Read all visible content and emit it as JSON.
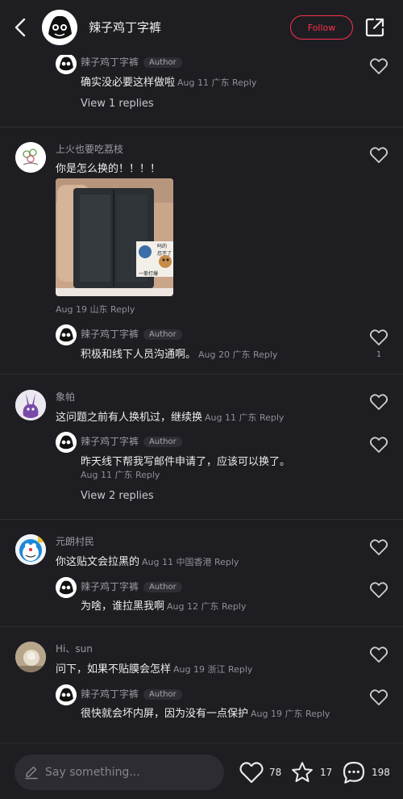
{
  "header": {
    "title": "辣子鸡丁字裤",
    "follow_label": "Follow"
  },
  "comments": {
    "c0": {
      "reply": {
        "user": "辣子鸡丁字裤",
        "badge": "Author",
        "text": "确实没必要这样做啦",
        "meta": "Aug 11 广东 Reply"
      },
      "view_replies": "View 1 replies"
    },
    "c1": {
      "user": "上火也要吃荔枝",
      "text": "你是怎么换的！！！！",
      "meta": "Aug 19 山东 Reply",
      "image_caption": {
        "top": "吗的",
        "mid": "忍不了",
        "bottom": "一拳打爆"
      },
      "reply": {
        "user": "辣子鸡丁字裤",
        "badge": "Author",
        "text": "积极和线下人员沟通啊。",
        "meta": "Aug 20 广东 Reply",
        "likes": "1"
      }
    },
    "c2": {
      "user": "象帕",
      "text": "这问题之前有人换机过，继续换",
      "meta": "Aug 11 广东 Reply",
      "reply": {
        "user": "辣子鸡丁字裤",
        "badge": "Author",
        "text": "昨天线下帮我写邮件申请了，应该可以换了。",
        "meta": "Aug 11 广东 Reply"
      },
      "view_replies": "View 2 replies"
    },
    "c3": {
      "user": "元朗村民",
      "text": "你这贴文会拉黑的",
      "meta": "Aug 11 中国香港 Reply",
      "reply": {
        "user": "辣子鸡丁字裤",
        "badge": "Author",
        "text": "为啥，谁拉黑我啊",
        "meta": "Aug 12 广东 Reply"
      }
    },
    "c4": {
      "user": "Hi、sun",
      "text": "问下，如果不贴膜会怎样",
      "meta": "Aug 19 浙江 Reply",
      "reply": {
        "user": "辣子鸡丁字裤",
        "badge": "Author",
        "text": "很快就会坏内屏，因为没有一点保护",
        "meta": "Aug 19 广东 Reply"
      }
    }
  },
  "bottom_bar": {
    "input_placeholder": "Say something...",
    "likes": "78",
    "stars": "17",
    "comments": "198"
  },
  "colors": {
    "accent": "#ff2e4d",
    "background": "#1e1e22"
  }
}
